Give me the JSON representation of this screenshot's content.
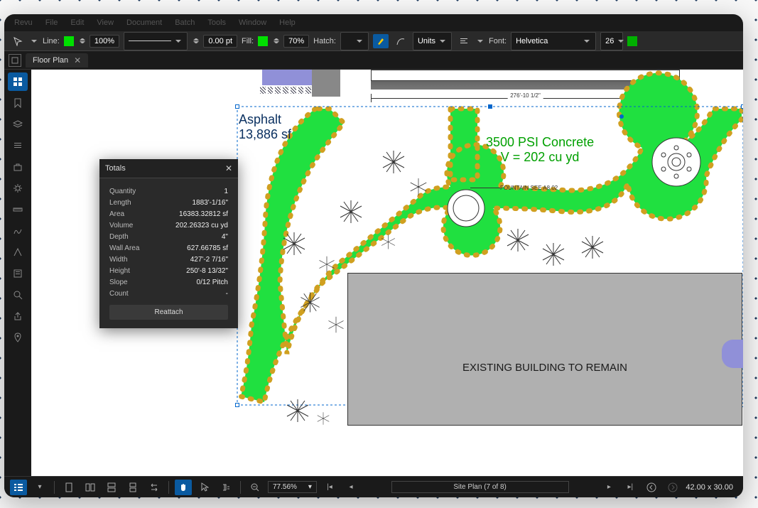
{
  "menus": [
    "Revu",
    "File",
    "Edit",
    "View",
    "Document",
    "Batch",
    "Tools",
    "Window",
    "Help"
  ],
  "toolbar": {
    "line_label": "Line:",
    "line_color": "#00e000",
    "zoom_pct": "100%",
    "lineweight": "0.00 pt",
    "fill_label": "Fill:",
    "fill_color": "#00e000",
    "fill_opacity": "70%",
    "hatch_label": "Hatch:",
    "units_label": "Units",
    "font_label": "Font:",
    "font_name": "Helvetica",
    "font_size": "26",
    "text_color": "#00b000"
  },
  "tab": {
    "name": "Floor Plan"
  },
  "drawing": {
    "dimension": "276'-10 1/2\"",
    "asphalt_l1": "Asphalt",
    "asphalt_l2": "13,886 sf",
    "concrete_l1": "3500 PSI Concrete",
    "concrete_l2": "V = 202 cu yd",
    "fountain": "FOUNTAIN SEE A8.02",
    "existing": "EXISTING BUILDING TO REMAIN"
  },
  "totals": {
    "title": "Totals",
    "rows": [
      {
        "k": "Quantity",
        "v": "1"
      },
      {
        "k": "Length",
        "v": "1883'-1/16\""
      },
      {
        "k": "Area",
        "v": "16383.32812 sf"
      },
      {
        "k": "Volume",
        "v": "202.26323 cu yd"
      },
      {
        "k": "Depth",
        "v": "4\""
      },
      {
        "k": "Wall Area",
        "v": "627.66785 sf"
      },
      {
        "k": "Width",
        "v": "427'-2 7/16\""
      },
      {
        "k": "Height",
        "v": "250'-8 13/32\""
      },
      {
        "k": "Slope",
        "v": "0/12 Pitch"
      },
      {
        "k": "Count",
        "v": "-"
      }
    ],
    "reattach": "Reattach"
  },
  "statusbar": {
    "zoom": "77.56%",
    "page": "Site Plan (7 of 8)",
    "dims": "42.00 x 30.00"
  }
}
